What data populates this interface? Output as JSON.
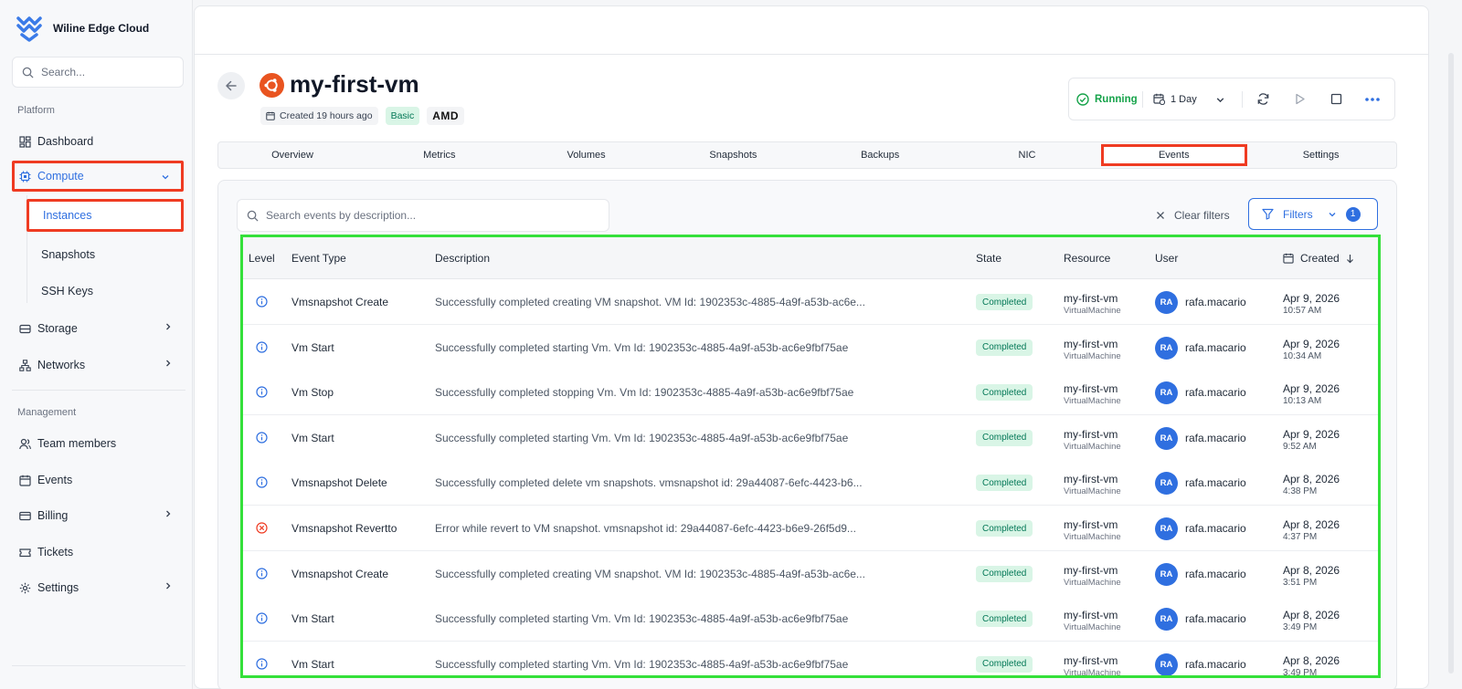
{
  "app": {
    "name": "Wiline Edge Cloud"
  },
  "sidebar": {
    "search_placeholder": "Search...",
    "platform_label": "Platform",
    "management_label": "Management",
    "items": {
      "dashboard": "Dashboard",
      "compute": "Compute",
      "instances": "Instances",
      "snapshots": "Snapshots",
      "ssh_keys": "SSH Keys",
      "storage": "Storage",
      "networks": "Networks",
      "team_members": "Team members",
      "events": "Events",
      "billing": "Billing",
      "tickets": "Tickets",
      "settings": "Settings"
    }
  },
  "vm": {
    "name": "my-first-vm",
    "created": "Created 19 hours ago",
    "plan": "Basic",
    "cpu_vendor": "AMD"
  },
  "status": {
    "state": "Running",
    "period": "1 Day"
  },
  "tabs": [
    "Overview",
    "Metrics",
    "Volumes",
    "Snapshots",
    "Backups",
    "NIC",
    "Events",
    "Settings"
  ],
  "active_tab": "Events",
  "events_filter": {
    "search_placeholder": "Search events by description...",
    "clear_label": "Clear filters",
    "filters_label": "Filters",
    "filters_count": "1"
  },
  "table": {
    "headers": {
      "level": "Level",
      "event_type": "Event Type",
      "description": "Description",
      "state": "State",
      "resource": "Resource",
      "user": "User",
      "created": "Created"
    },
    "rows": [
      {
        "level": "info",
        "type": "Vmsnapshot Create",
        "description": "Successfully completed creating VM snapshot. VM Id: 1902353c-4885-4a9f-a53b-ac6e...",
        "state": "Completed",
        "resource": "my-first-vm",
        "resource_type": "VirtualMachine",
        "initials": "RA",
        "user": "rafa.macario",
        "date": "Apr 9, 2026",
        "time": "10:57 AM"
      },
      {
        "level": "info",
        "type": "Vm Start",
        "description": "Successfully completed starting Vm. Vm Id: 1902353c-4885-4a9f-a53b-ac6e9fbf75ae",
        "state": "Completed",
        "resource": "my-first-vm",
        "resource_type": "VirtualMachine",
        "initials": "RA",
        "user": "rafa.macario",
        "date": "Apr 9, 2026",
        "time": "10:34 AM"
      },
      {
        "level": "info",
        "type": "Vm Stop",
        "description": "Successfully completed stopping Vm. Vm Id: 1902353c-4885-4a9f-a53b-ac6e9fbf75ae",
        "state": "Completed",
        "resource": "my-first-vm",
        "resource_type": "VirtualMachine",
        "initials": "RA",
        "user": "rafa.macario",
        "date": "Apr 9, 2026",
        "time": "10:13 AM"
      },
      {
        "level": "info",
        "type": "Vm Start",
        "description": "Successfully completed starting Vm. Vm Id: 1902353c-4885-4a9f-a53b-ac6e9fbf75ae",
        "state": "Completed",
        "resource": "my-first-vm",
        "resource_type": "VirtualMachine",
        "initials": "RA",
        "user": "rafa.macario",
        "date": "Apr 9, 2026",
        "time": "9:52 AM"
      },
      {
        "level": "info",
        "type": "Vmsnapshot Delete",
        "description": "Successfully completed delete vm snapshots. vmsnapshot id: 29a44087-6efc-4423-b6...",
        "state": "Completed",
        "resource": "my-first-vm",
        "resource_type": "VirtualMachine",
        "initials": "RA",
        "user": "rafa.macario",
        "date": "Apr 8, 2026",
        "time": "4:38 PM"
      },
      {
        "level": "error",
        "type": "Vmsnapshot Revertto",
        "description": "Error while revert to VM snapshot. vmsnapshot id: 29a44087-6efc-4423-b6e9-26f5d9...",
        "state": "Completed",
        "resource": "my-first-vm",
        "resource_type": "VirtualMachine",
        "initials": "RA",
        "user": "rafa.macario",
        "date": "Apr 8, 2026",
        "time": "4:37 PM"
      },
      {
        "level": "info",
        "type": "Vmsnapshot Create",
        "description": "Successfully completed creating VM snapshot. VM Id: 1902353c-4885-4a9f-a53b-ac6e...",
        "state": "Completed",
        "resource": "my-first-vm",
        "resource_type": "VirtualMachine",
        "initials": "RA",
        "user": "rafa.macario",
        "date": "Apr 8, 2026",
        "time": "3:51 PM"
      },
      {
        "level": "info",
        "type": "Vm Start",
        "description": "Successfully completed starting Vm. Vm Id: 1902353c-4885-4a9f-a53b-ac6e9fbf75ae",
        "state": "Completed",
        "resource": "my-first-vm",
        "resource_type": "VirtualMachine",
        "initials": "RA",
        "user": "rafa.macario",
        "date": "Apr 8, 2026",
        "time": "3:49 PM"
      },
      {
        "level": "info",
        "type": "Vm Start",
        "description": "Successfully completed starting Vm. Vm Id: 1902353c-4885-4a9f-a53b-ac6e9fbf75ae",
        "state": "Completed",
        "resource": "my-first-vm",
        "resource_type": "VirtualMachine",
        "initials": "RA",
        "user": "rafa.macario",
        "date": "Apr 8, 2026",
        "time": "3:49 PM"
      }
    ]
  },
  "colors": {
    "accent": "#2f6fe0",
    "success": "#16a34a",
    "error": "#ef3b22",
    "highlight_red": "#ef3b22",
    "highlight_green": "#34e03a"
  }
}
